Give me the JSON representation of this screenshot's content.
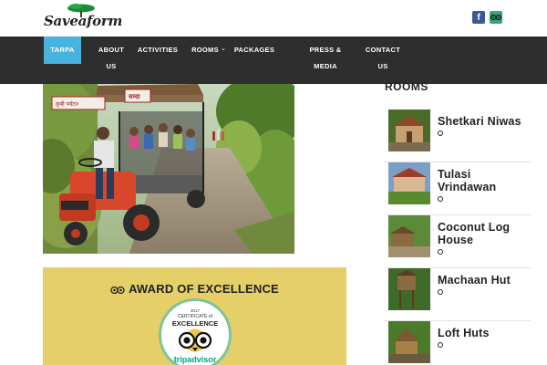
{
  "header": {
    "logo_text": "Saveaform",
    "social": [
      {
        "label": "f",
        "icon": "facebook-icon"
      },
      {
        "label": "",
        "icon": "tripadvisor-icon"
      }
    ]
  },
  "nav": {
    "items": [
      {
        "label": "TARPA",
        "active": true
      },
      {
        "label": "ABOUT",
        "label2": "US"
      },
      {
        "label": "ACTIVITIES"
      },
      {
        "label": "ROOMS",
        "has_dropdown": true
      },
      {
        "label": "PACKAGES"
      },
      {
        "label": "PRESS &",
        "label2": "MEDIA"
      },
      {
        "label": "CONTACT",
        "label2": "US"
      }
    ],
    "active_color": "#49b3e0",
    "bar_color": "#2e2e2e"
  },
  "hero": {
    "sign_text": "सम्दा",
    "sign2_text": "कृषी पर्यटन"
  },
  "award": {
    "title": "AWARD OF EXCELLENCE",
    "cert_year": "2017",
    "cert_line1": "CERTIFICATE of",
    "cert_line2": "EXCELLENCE",
    "brand": "tripadvisor",
    "bg_color": "#e5cf68"
  },
  "sidebar": {
    "heading": "ROOMS",
    "rooms": [
      {
        "name": "Shetkari Niwas"
      },
      {
        "name": "Tulasi Vrindawan"
      },
      {
        "name": "Coconut Log House"
      },
      {
        "name": "Machaan Hut"
      },
      {
        "name": "Loft Huts"
      }
    ]
  }
}
